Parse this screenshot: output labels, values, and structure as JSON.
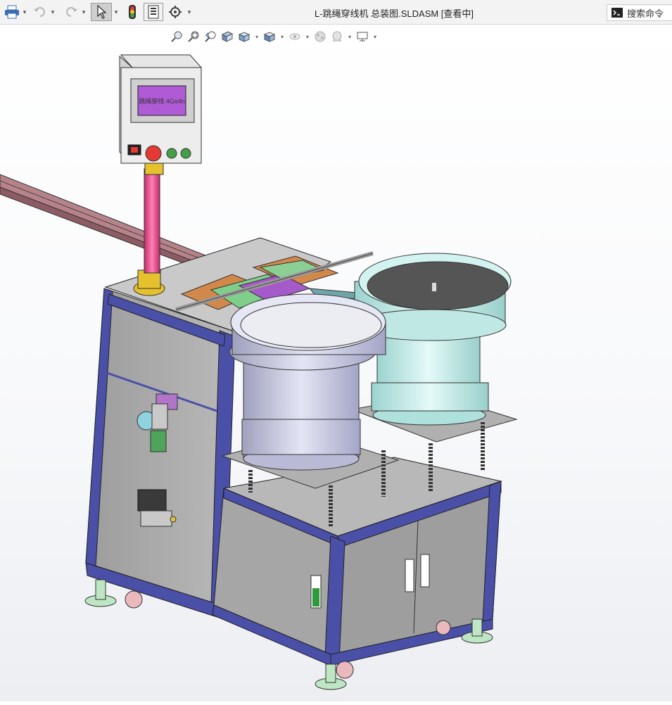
{
  "window": {
    "title": "L-跳绳穿线机 总装图.SLDASM [查看中]",
    "search_label": "搜索命令"
  },
  "toolbar": {
    "items": [
      "print-icon",
      "undo-icon",
      "redo-icon",
      "select-icon",
      "rebuild-icon",
      "file-properties-icon",
      "options-icon"
    ]
  },
  "heads_up_toolbar": {
    "items": [
      "zoom-to-fit-icon",
      "zoom-to-area-icon",
      "previous-view-icon",
      "section-view-icon",
      "view-orientation-icon",
      "display-style-icon",
      "hide-show-icon",
      "edit-appearance-icon",
      "apply-scene-icon",
      "view-settings-icon"
    ]
  },
  "model": {
    "hmi_screen_text": "跳绳穿线 4Go4n"
  },
  "colors": {
    "frame_blue": "#4a4fa8",
    "panel_grey": "#a9a9a9",
    "bowl_left": "#c9cbe0",
    "bowl_right": "#c6ece9",
    "hmi_screen": "#b05bd6",
    "pillar_pink": "#e8508a"
  }
}
